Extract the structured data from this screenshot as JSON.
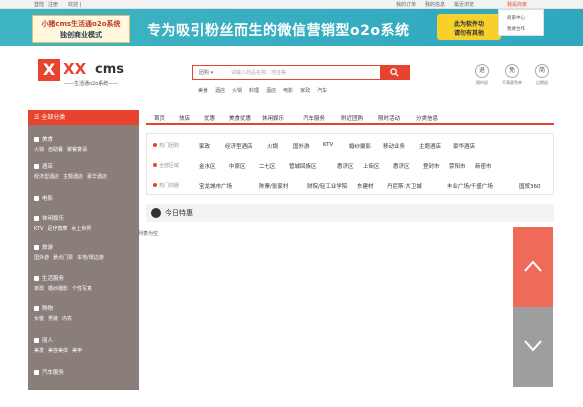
{
  "topbar": {
    "login": "登陆",
    "register": "注册",
    "city": "欢迎 |",
    "orders": "我的订单",
    "my": "我的信息",
    "recent": "最近浏览",
    "merchant": "我是商家"
  },
  "dropdown": {
    "item1": "商家中心",
    "item2": "我要合作"
  },
  "banner": {
    "left_line1": "小猪cms生活通o2o系统",
    "left_line2": "独创商业模式",
    "slogan": "专为吸引粉丝而生的微信营销型o2o系统",
    "right_line1": "此为软件功",
    "right_line2": "请勿有其他"
  },
  "logo": {
    "x": "X",
    "xx": "XX",
    "cms": "cms",
    "sub": "——生活通o2o系统——"
  },
  "search": {
    "category": "团购",
    "placeholder": "请输入商品名称、地址等"
  },
  "hotwords": [
    "美食",
    "酒店",
    "火锅",
    "料理",
    "酒店",
    "电影",
    "家政",
    "汽车"
  ],
  "badges": [
    {
      "char": "退",
      "text": "随时退"
    },
    {
      "char": "免",
      "text": "不满意免单"
    },
    {
      "char": "简",
      "text": "过期退"
    }
  ],
  "sidebar": {
    "title": "全部分类",
    "categories": [
      {
        "title": "美食",
        "subs": [
          "火锅",
          "自助餐",
          "聚餐宴请"
        ]
      },
      {
        "title": "酒店",
        "subs": [
          "经济型酒店",
          "主题酒店",
          "豪华酒店"
        ]
      },
      {
        "title": "电影",
        "subs": []
      },
      {
        "title": "休闲娱乐",
        "subs": [
          "KTV",
          "足疗按摩",
          "水上世界"
        ]
      },
      {
        "title": "旅游",
        "subs": [
          "国外游",
          "景点门票",
          "本地/周边游"
        ]
      },
      {
        "title": "生活服务",
        "subs": [
          "家政",
          "婚纱摄影",
          "个性写真"
        ]
      },
      {
        "title": "购物",
        "subs": [
          "女装",
          "男装",
          "内衣"
        ]
      },
      {
        "title": "丽人",
        "subs": [
          "美发",
          "美容美体",
          "美甲"
        ]
      },
      {
        "title": "汽车服务",
        "subs": []
      }
    ]
  },
  "nav": [
    "首页",
    "快店",
    "优惠",
    "美食优惠",
    "休闲娱乐",
    "汽车服务",
    "附近团购",
    "限时活动",
    "分类信息"
  ],
  "filter": {
    "rows": [
      {
        "label": "热门团购",
        "items": [
          "家政",
          "经济型酒店",
          "火锅",
          "国外游",
          "KTV",
          "婚纱摄影",
          "移动业务",
          "主题酒店",
          "豪华酒店"
        ]
      },
      {
        "label": "全部区域",
        "items": [
          "金水区",
          "中原区",
          "二七区",
          "管城回族区",
          "惠济区",
          "上街区",
          "惠济区",
          "登封市",
          "荥阳市",
          "新密市"
        ]
      },
      {
        "label": "热门商圈",
        "items": [
          "国贸360",
          "宝龙城市广场",
          "陈寨/张家村",
          "财院/轻工业学院",
          "东建材",
          "丹尼斯·大卫城",
          "丰业广场/千盛广场"
        ]
      }
    ]
  },
  "today": {
    "title": "今日特惠"
  },
  "empty_text": "列表为空",
  "colors": {
    "accent": "#e8432e",
    "banner": "#3fb4c4",
    "sidebar": "#8a7e7a"
  }
}
